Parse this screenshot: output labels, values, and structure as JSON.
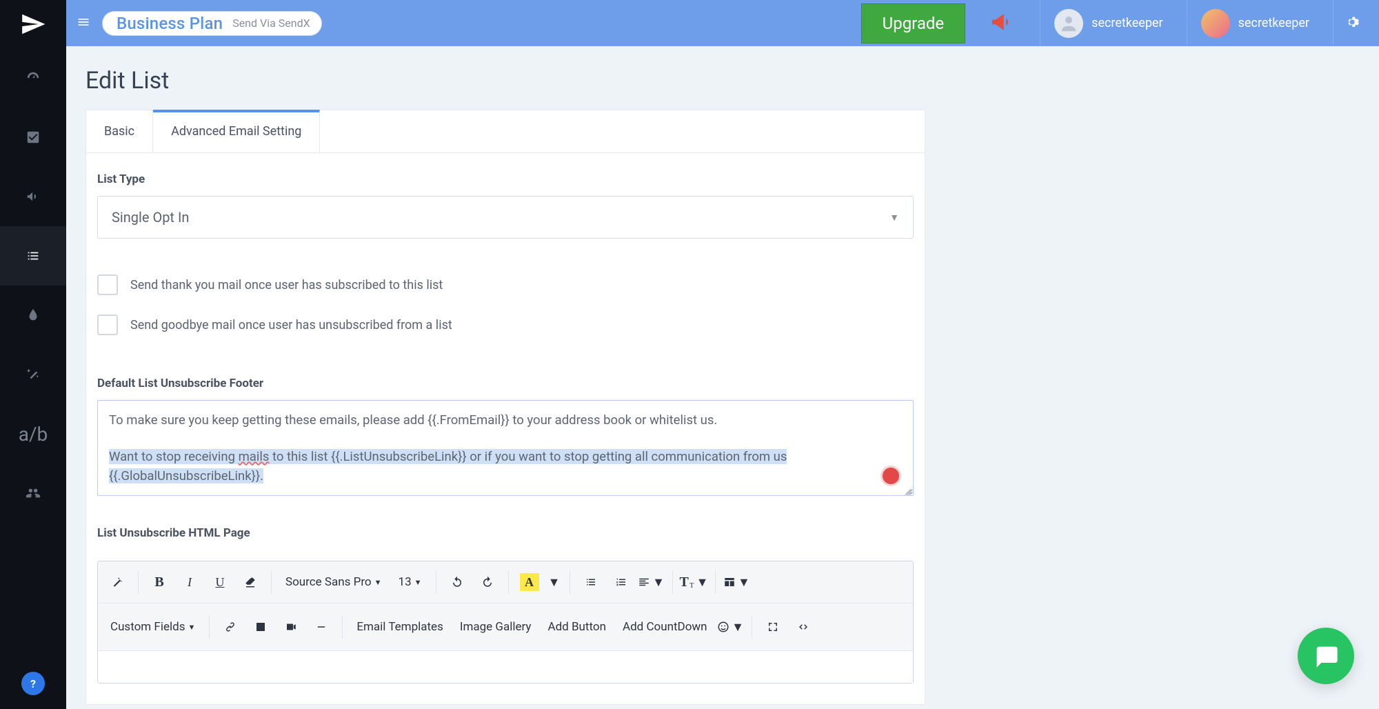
{
  "topbar": {
    "plan_label": "Business Plan",
    "via_label": "Send Via SendX",
    "upgrade_label": "Upgrade",
    "user1_name": "secretkeeper",
    "user2_name": "secretkeeper"
  },
  "page": {
    "title": "Edit List"
  },
  "tabs": {
    "basic": "Basic",
    "advanced": "Advanced Email Setting"
  },
  "form": {
    "list_type_label": "List Type",
    "list_type_value": "Single Opt In",
    "thank_you_label": "Send thank you mail once user has subscribed to this list",
    "goodbye_label": "Send goodbye mail once user has unsubscribed from a list",
    "footer_label": "Default List Unsubscribe Footer",
    "footer_line1": "To make sure you keep getting these emails, please add {{.FromEmail}} to your address book or whitelist us.",
    "footer_sel_pre": "Want to stop receiving ",
    "footer_sel_err": "mails",
    "footer_sel_post": " to this list {{.ListUnsubscribeLink}} or if you want to stop getting all communication from us  {{.GlobalUnsubscribeLink}}.",
    "html_page_label": "List Unsubscribe HTML Page"
  },
  "editor": {
    "font_family": "Source Sans Pro",
    "font_size": "13",
    "custom_fields": "Custom Fields",
    "email_templates": "Email Templates",
    "image_gallery": "Image Gallery",
    "add_button": "Add Button",
    "add_countdown": "Add CountDown"
  },
  "sidebar": {
    "ab_label": "a/b"
  }
}
